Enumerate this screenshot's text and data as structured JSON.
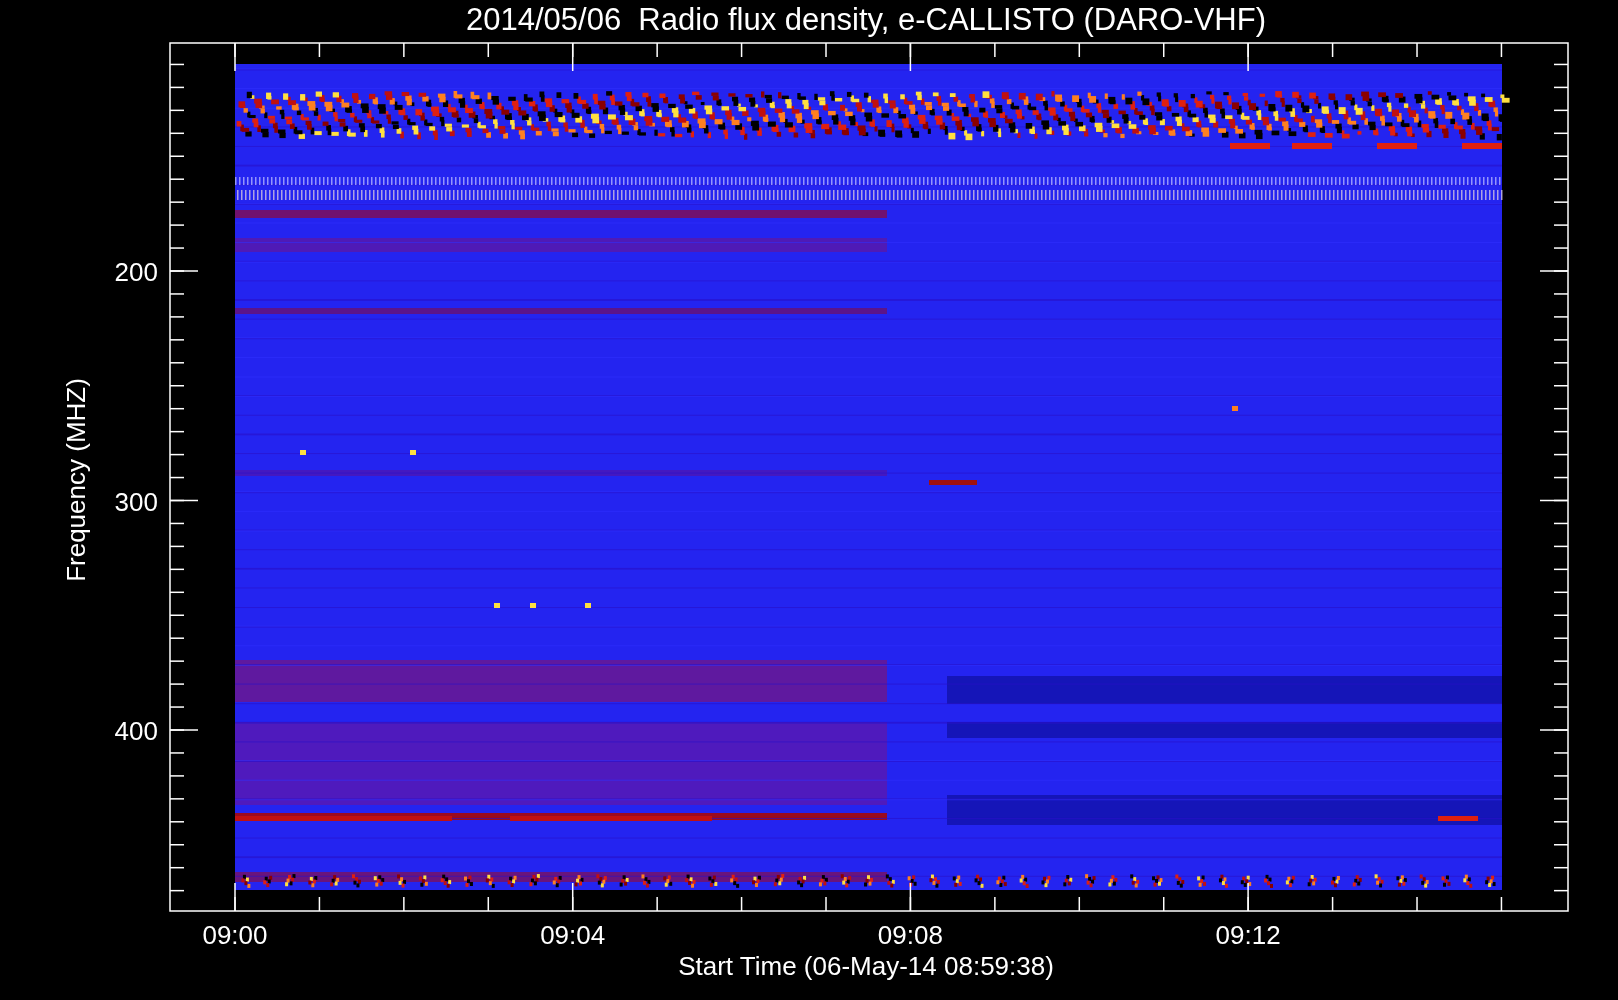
{
  "title": "2014/05/06  Radio flux density, e-CALLISTO (DARO-VHF)",
  "y_axis": {
    "label": "Frequency (MHZ)",
    "ticks": [
      "200",
      "300",
      "400"
    ]
  },
  "x_axis": {
    "label": "Start Time (06-May-14 08:59:38)",
    "ticks": [
      "09:00",
      "09:04",
      "09:08",
      "09:12"
    ]
  }
}
